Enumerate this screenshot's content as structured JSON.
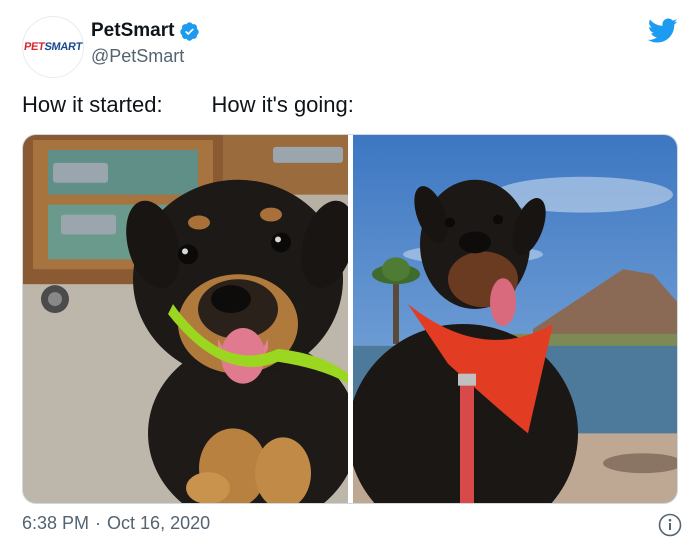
{
  "tweet": {
    "display_name": "PetSmart",
    "handle": "@PetSmart",
    "text": "How it started:        How it's going:",
    "time": "6:38 PM",
    "separator": "·",
    "date": "Oct 16, 2020"
  },
  "avatar": {
    "logo_pet": "PET",
    "logo_smart": "SMART"
  },
  "images": [
    {
      "name": "puppy-photo"
    },
    {
      "name": "grown-dog-photo"
    }
  ],
  "icons": {
    "verified": "verified-badge-icon",
    "twitter": "twitter-bird-icon",
    "info": "info-icon"
  },
  "colors": {
    "verified_blue": "#1d9bf0",
    "twitter_blue": "#1d9bf0",
    "text": "#0f1419",
    "secondary_text": "#536471"
  }
}
